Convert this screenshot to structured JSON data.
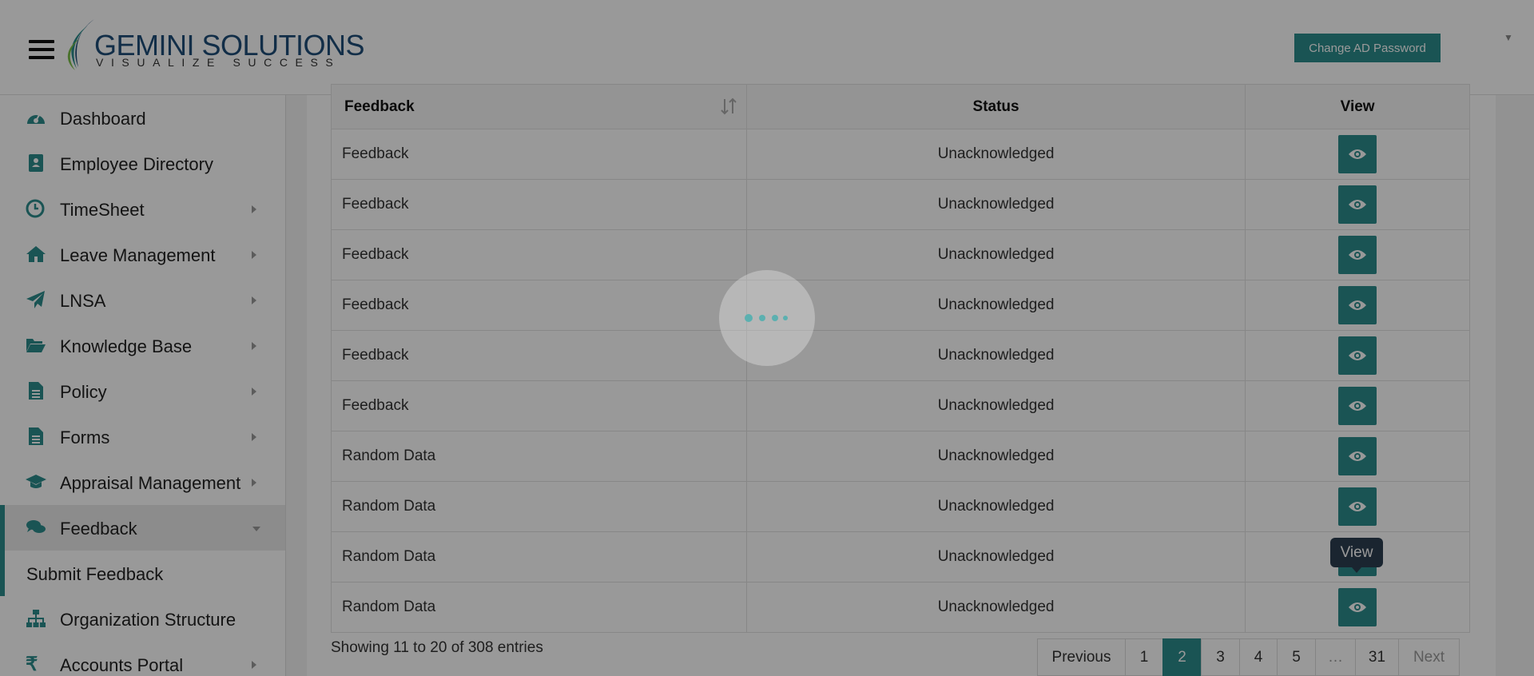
{
  "header": {
    "logo_main_a": "GEMINI",
    "logo_main_b": "SOLUTIONS",
    "logo_sub": "VISUALIZE SUCCESS",
    "change_password_label": "Change AD Password"
  },
  "sidebar": {
    "items": [
      {
        "label": "Dashboard",
        "icon": "dashboard-icon"
      },
      {
        "label": "Employee Directory",
        "icon": "contact-book-icon"
      },
      {
        "label": "TimeSheet",
        "icon": "clock-icon"
      },
      {
        "label": "Leave Management",
        "icon": "home-icon"
      },
      {
        "label": "LNSA",
        "icon": "paper-plane-icon"
      },
      {
        "label": "Knowledge Base",
        "icon": "folder-open-icon"
      },
      {
        "label": "Policy",
        "icon": "document-icon"
      },
      {
        "label": "Forms",
        "icon": "document-icon"
      },
      {
        "label": "Appraisal Management",
        "icon": "graduation-cap-icon"
      },
      {
        "label": "Feedback",
        "icon": "comments-icon"
      },
      {
        "label": "Organization Structure",
        "icon": "sitemap-icon"
      },
      {
        "label": "Accounts Portal",
        "icon": "rupee-icon"
      }
    ],
    "sub_item": "Submit Feedback"
  },
  "table": {
    "headers": [
      "Feedback",
      "Status",
      "View"
    ],
    "rows": [
      {
        "feedback": "Feedback",
        "status": "Unacknowledged"
      },
      {
        "feedback": "Feedback",
        "status": "Unacknowledged"
      },
      {
        "feedback": "Feedback",
        "status": "Unacknowledged"
      },
      {
        "feedback": "Feedback",
        "status": "Unacknowledged"
      },
      {
        "feedback": "Feedback",
        "status": "Unacknowledged"
      },
      {
        "feedback": "Feedback",
        "status": "Unacknowledged"
      },
      {
        "feedback": "Random Data",
        "status": "Unacknowledged"
      },
      {
        "feedback": "Random Data",
        "status": "Unacknowledged"
      },
      {
        "feedback": "Random Data",
        "status": "Unacknowledged"
      },
      {
        "feedback": "Random Data",
        "status": "Unacknowledged"
      }
    ]
  },
  "tooltip": "View",
  "pagination": {
    "showing": "Showing 11 to 20 of 308 entries",
    "previous": "Previous",
    "pages": [
      "1",
      "2",
      "3",
      "4",
      "5",
      "…",
      "31"
    ],
    "current": "2",
    "next": "Next"
  },
  "colors": {
    "accent": "#2c8c8c",
    "tooltip_bg": "#2c3e50"
  }
}
